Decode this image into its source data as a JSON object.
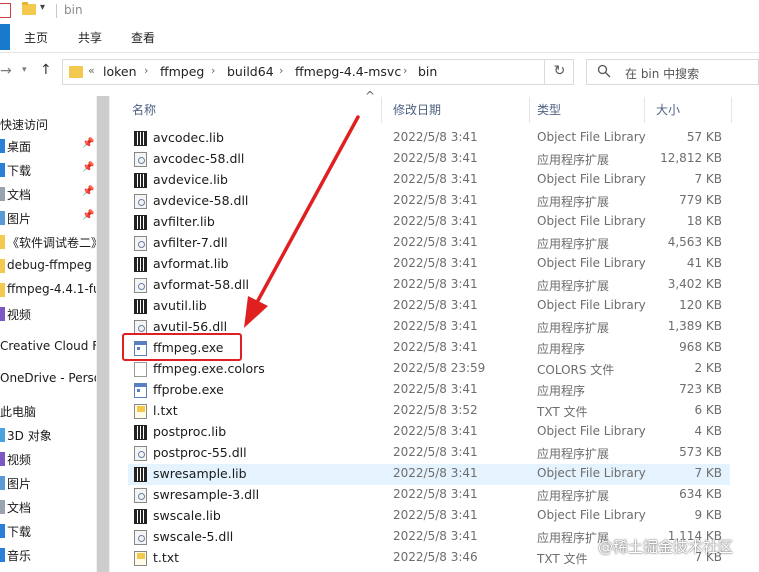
{
  "window": {
    "title": "bin"
  },
  "ribbon": {
    "tabs": [
      "主页",
      "共享",
      "查看"
    ]
  },
  "address": {
    "separator": "«",
    "crumbs": [
      "loken",
      "ffmpeg",
      "build64",
      "ffmepg-4.4-msvc",
      "bin"
    ],
    "search_placeholder": "在 bin 中搜索"
  },
  "sidebar": {
    "items": [
      {
        "label": "快速访问"
      },
      {
        "label": "桌面"
      },
      {
        "label": "下载"
      },
      {
        "label": "文档"
      },
      {
        "label": "图片"
      },
      {
        "label": "《软件调试卷二》"
      },
      {
        "label": "debug-ffmpeg"
      },
      {
        "label": "ffmpeg-4.4.1-full"
      },
      {
        "label": "视频"
      },
      {
        "label": "Creative Cloud Files"
      },
      {
        "label": "OneDrive - Personal"
      },
      {
        "label": "此电脑"
      },
      {
        "label": "3D 对象"
      },
      {
        "label": "视频"
      },
      {
        "label": "图片"
      },
      {
        "label": "文档"
      },
      {
        "label": "下载"
      },
      {
        "label": "音乐"
      }
    ]
  },
  "columns": {
    "name": "名称",
    "date": "修改日期",
    "type": "类型",
    "size": "大小"
  },
  "files": [
    {
      "name": "avcodec.lib",
      "date": "2022/5/8 3:41",
      "type": "Object File Library",
      "size": "57 KB",
      "icon": "lib"
    },
    {
      "name": "avcodec-58.dll",
      "date": "2022/5/8 3:41",
      "type": "应用程序扩展",
      "size": "12,812 KB",
      "icon": "dll"
    },
    {
      "name": "avdevice.lib",
      "date": "2022/5/8 3:41",
      "type": "Object File Library",
      "size": "7 KB",
      "icon": "lib"
    },
    {
      "name": "avdevice-58.dll",
      "date": "2022/5/8 3:41",
      "type": "应用程序扩展",
      "size": "779 KB",
      "icon": "dll"
    },
    {
      "name": "avfilter.lib",
      "date": "2022/5/8 3:41",
      "type": "Object File Library",
      "size": "18 KB",
      "icon": "lib"
    },
    {
      "name": "avfilter-7.dll",
      "date": "2022/5/8 3:41",
      "type": "应用程序扩展",
      "size": "4,563 KB",
      "icon": "dll"
    },
    {
      "name": "avformat.lib",
      "date": "2022/5/8 3:41",
      "type": "Object File Library",
      "size": "41 KB",
      "icon": "lib"
    },
    {
      "name": "avformat-58.dll",
      "date": "2022/5/8 3:41",
      "type": "应用程序扩展",
      "size": "3,402 KB",
      "icon": "dll"
    },
    {
      "name": "avutil.lib",
      "date": "2022/5/8 3:41",
      "type": "Object File Library",
      "size": "120 KB",
      "icon": "lib"
    },
    {
      "name": "avutil-56.dll",
      "date": "2022/5/8 3:41",
      "type": "应用程序扩展",
      "size": "1,389 KB",
      "icon": "dll"
    },
    {
      "name": "ffmpeg.exe",
      "date": "2022/5/8 3:41",
      "type": "应用程序",
      "size": "968 KB",
      "icon": "exe"
    },
    {
      "name": "ffmpeg.exe.colors",
      "date": "2022/5/8 23:59",
      "type": "COLORS 文件",
      "size": "2 KB",
      "icon": "colors"
    },
    {
      "name": "ffprobe.exe",
      "date": "2022/5/8 3:41",
      "type": "应用程序",
      "size": "723 KB",
      "icon": "exe"
    },
    {
      "name": "l.txt",
      "date": "2022/5/8 3:52",
      "type": "TXT 文件",
      "size": "6 KB",
      "icon": "txt"
    },
    {
      "name": "postproc.lib",
      "date": "2022/5/8 3:41",
      "type": "Object File Library",
      "size": "4 KB",
      "icon": "lib"
    },
    {
      "name": "postproc-55.dll",
      "date": "2022/5/8 3:41",
      "type": "应用程序扩展",
      "size": "573 KB",
      "icon": "dll"
    },
    {
      "name": "swresample.lib",
      "date": "2022/5/8 3:41",
      "type": "Object File Library",
      "size": "7 KB",
      "icon": "lib"
    },
    {
      "name": "swresample-3.dll",
      "date": "2022/5/8 3:41",
      "type": "应用程序扩展",
      "size": "634 KB",
      "icon": "dll"
    },
    {
      "name": "swscale.lib",
      "date": "2022/5/8 3:41",
      "type": "Object File Library",
      "size": "9 KB",
      "icon": "lib"
    },
    {
      "name": "swscale-5.dll",
      "date": "2022/5/8 3:41",
      "type": "应用程序扩展",
      "size": "1,114 KB",
      "icon": "dll"
    },
    {
      "name": "t.txt",
      "date": "2022/5/8 3:46",
      "type": "TXT 文件",
      "size": "7 KB",
      "icon": "txt"
    }
  ],
  "annotation": {
    "highlighted_file": "ffmpeg.exe",
    "color": "#e02020"
  },
  "watermark": "@稀土掘金技术社区"
}
